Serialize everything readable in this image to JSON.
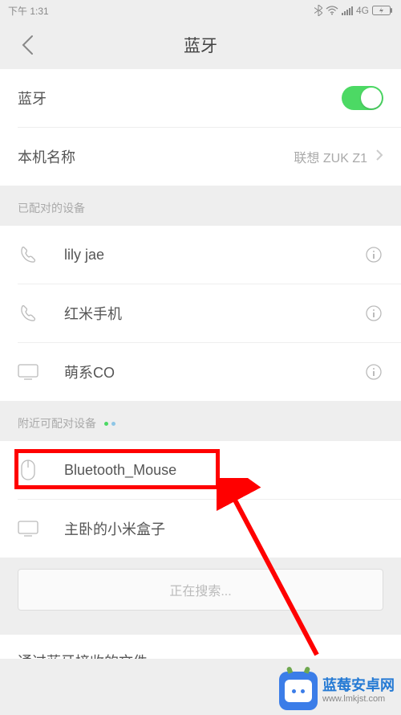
{
  "status": {
    "time": "下午 1:31",
    "network": "4G"
  },
  "header": {
    "title": "蓝牙"
  },
  "settings": {
    "bluetooth_label": "蓝牙",
    "bluetooth_on": true,
    "device_name_label": "本机名称",
    "device_name_value": "联想 ZUK Z1"
  },
  "sections": {
    "paired_header": "已配对的设备",
    "available_header": "附近可配对设备"
  },
  "paired_devices": [
    {
      "name": "lily jae",
      "icon": "phone"
    },
    {
      "name": "红米手机",
      "icon": "phone"
    },
    {
      "name": "萌系CO",
      "icon": "display"
    }
  ],
  "available_devices": [
    {
      "name": "Bluetooth_Mouse",
      "icon": "mouse"
    },
    {
      "name": "主卧的小米盒子",
      "icon": "display"
    }
  ],
  "search": {
    "status": "正在搜索..."
  },
  "cut_section": {
    "label": "通过蓝牙接收的文件"
  },
  "watermark": {
    "line1": "蓝莓安卓网",
    "line2": "www.lmkjst.com"
  },
  "highlight": {
    "target": "Bluetooth_Mouse"
  }
}
